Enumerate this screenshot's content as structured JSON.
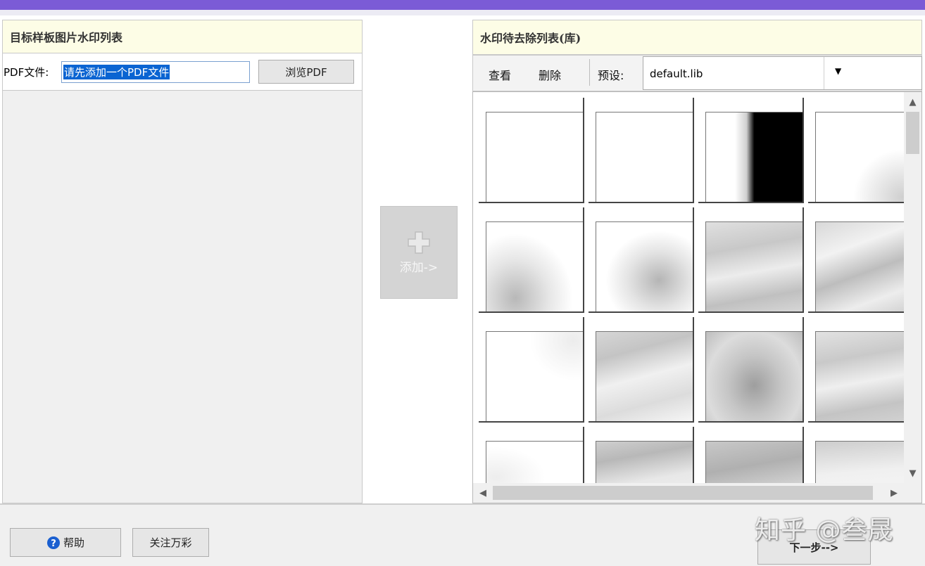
{
  "left_panel": {
    "title": "目标样板图片水印列表",
    "pdf_label": "PDF文件:",
    "pdf_input_value": "请先添加一个PDF文件",
    "browse_button": "浏览PDF"
  },
  "add_button": {
    "label": "添加->",
    "icon": "plus-icon"
  },
  "right_panel": {
    "title": "水印待去除列表(库)",
    "view_button": "查看",
    "delete_button": "删除",
    "preset_label": "预设:",
    "preset_value": "default.lib"
  },
  "footer": {
    "help_button": "帮助",
    "help_icon": "question-circle-icon",
    "follow_button": "关注万彩",
    "next_button": "下一步-->",
    "watermark": "知乎 @叁晟"
  },
  "colors": {
    "titlebar": "#7b5bd6",
    "panel_header": "#fdfde6",
    "selection": "#0a64d2"
  }
}
